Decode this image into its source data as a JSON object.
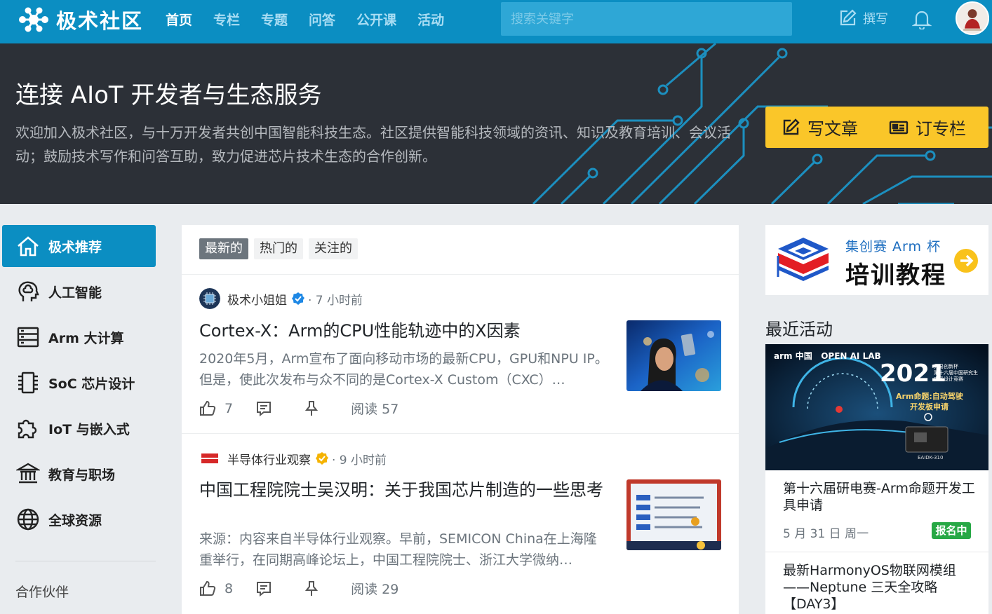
{
  "brand": {
    "name": "极术社区"
  },
  "nav": {
    "items": [
      {
        "label": "首页",
        "active": true
      },
      {
        "label": "专栏"
      },
      {
        "label": "专题"
      },
      {
        "label": "问答"
      },
      {
        "label": "公开课"
      },
      {
        "label": "活动"
      }
    ]
  },
  "search": {
    "placeholder": "搜索关键字"
  },
  "header": {
    "write_label": "撰写"
  },
  "hero": {
    "title": "连接 AIoT 开发者与生态服务",
    "description": "欢迎加入极术社区，与十万开发者共创中国智能科技生态。社区提供智能科技领域的资讯、知识及教育培训、会议活动；鼓励技术写作和问答互助，致力促进芯片技术生态的合作创新。",
    "write_article": "写文章",
    "subscribe": "订专栏"
  },
  "sidebar": {
    "items": [
      {
        "label": "极术推荐",
        "icon": "home-icon",
        "active": true
      },
      {
        "label": "人工智能",
        "icon": "brain-head-icon"
      },
      {
        "label": "Arm 大计算",
        "icon": "server-icon"
      },
      {
        "label": "SoC 芯片设计",
        "icon": "chip-icon"
      },
      {
        "label": "IoT 与嵌入式",
        "icon": "puzzle-icon"
      },
      {
        "label": "教育与职场",
        "icon": "institution-icon"
      },
      {
        "label": "全球资源",
        "icon": "globe-icon"
      }
    ],
    "partners": "合作伙伴"
  },
  "feed": {
    "tabs": [
      {
        "label": "最新的",
        "active": true
      },
      {
        "label": "热门的"
      },
      {
        "label": "关注的"
      }
    ],
    "posts": [
      {
        "author": "极术小姐姐",
        "time": "· 7 小时前",
        "title": "Cortex-X：Arm的CPU性能轨迹中的X因素",
        "excerpt": "2020年5月，Arm宣布了面向移动市场的最新CPU，GPU和NPU IP。但是，使此次发布与众不同的是Cortex-X Custom（CXC）…",
        "likes": "7",
        "reads": "阅读 57",
        "verified_color": "#1e88e5"
      },
      {
        "author": "半导体行业观察",
        "time": "· 9 小时前",
        "title": "中国工程院院士吴汉明：关于我国芯片制造的一些思考",
        "excerpt": "来源：内容来自半导体行业观察。早前，SEMICON China在上海隆重举行，在同期高峰论坛上，中国工程院院士、浙江大学微纳…",
        "likes": "8",
        "reads": "阅读 29",
        "verified_color": "#f5b301",
        "avatar_text": "半导体行业观察"
      }
    ]
  },
  "promo": {
    "subtitle": "集创赛 Arm 杯",
    "title": "培训教程"
  },
  "recent": {
    "heading": "最近活动",
    "events": [
      {
        "banner_brand": "arm 中国   OPEN AI LAB",
        "banner_year": "2021",
        "banner_note": "兆易创新杯\n第十六届中国研究生\n电子设计竞赛",
        "banner_topic": "Arm命题:自动驾驶",
        "banner_topic2": "开发板申请",
        "banner_board": "EAIDK-310",
        "title": "第十六届研电赛-Arm命题开发工具申请",
        "date": "5 月 31 日 周一",
        "status": "报名中"
      },
      {
        "title": "最新HarmonyOS物联网模组——Neptune 三天全攻略【DAY3】"
      }
    ]
  },
  "colors": {
    "nav_bg": "#0b8ec2",
    "hero_bg": "#2c3037",
    "cta_yellow": "#fac629",
    "status_green": "#27a845"
  }
}
